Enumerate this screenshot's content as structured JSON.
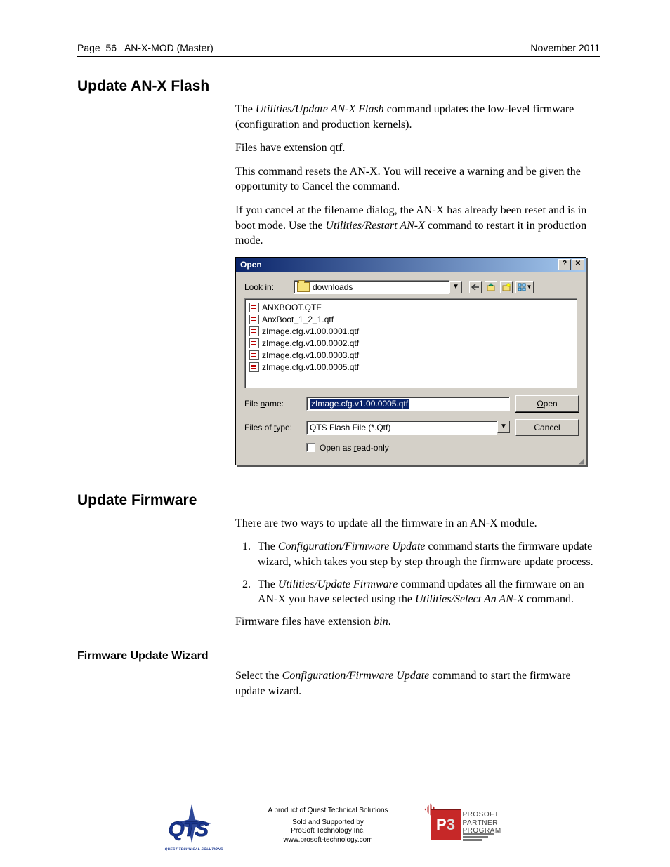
{
  "header": {
    "page_label": "Page",
    "page_number": "56",
    "doc_title": "AN-X-MOD (Master)",
    "date": "November 2011"
  },
  "s1": {
    "heading": "Update AN-X Flash",
    "p1_a": "The ",
    "p1_cmd": "Utilities/Update AN-X Flash",
    "p1_b": " command updates the low-level firmware (configuration and production kernels).",
    "p2": "Files have extension qtf.",
    "p3": "This command resets the AN-X.  You will receive a warning and be given the opportunity to Cancel the command.",
    "p4_a": "If you cancel at the filename dialog, the AN-X has already been reset and is in boot mode.  Use the ",
    "p4_cmd": "Utilities/Restart AN-X",
    "p4_b": " command to restart it in production mode."
  },
  "dialog": {
    "title": "Open",
    "lookin_label": "Look in:",
    "lookin_value": "downloads",
    "files": [
      "ANXBOOT.QTF",
      "AnxBoot_1_2_1.qtf",
      "zImage.cfg.v1.00.0001.qtf",
      "zImage.cfg.v1.00.0002.qtf",
      "zImage.cfg.v1.00.0003.qtf",
      "zImage.cfg.v1.00.0005.qtf"
    ],
    "filename_label": "File name:",
    "filename_value": "zImage.cfg.v1.00.0005.qtf",
    "filetype_label": "Files of type:",
    "filetype_value": "QTS Flash File (*.Qtf)",
    "readonly_label": "Open as read-only",
    "open_btn": "Open",
    "cancel_btn": "Cancel",
    "toolbar_icons": [
      "back-icon",
      "up-level-icon",
      "new-folder-icon",
      "views-icon"
    ]
  },
  "s2": {
    "heading": "Update Firmware",
    "p1": "There are two ways to update all the firmware in an AN-X module.",
    "li1_a": "The ",
    "li1_cmd": "Configuration/Firmware Update",
    "li1_b": " command starts the firmware update wizard, which takes you step by step through the firmware update process.",
    "li2_a": "The ",
    "li2_cmd1": "Utilities/Update Firmware",
    "li2_b": " command updates all the firmware on an AN-X you have selected using the ",
    "li2_cmd2": "Utilities/Select An AN-X",
    "li2_c": " command.",
    "p2_a": "Firmware files have extension ",
    "p2_em": "bin",
    "p2_b": "."
  },
  "s3": {
    "heading": "Firmware Update Wizard",
    "p1_a": "Select the ",
    "p1_cmd": "Configuration/Firmware Update",
    "p1_b": " command to start the firmware update wizard."
  },
  "footer": {
    "line1": "A product of Quest Technical Solutions",
    "line2": "Sold and Supported by",
    "line3": "ProSoft Technology Inc.",
    "line4": "www.prosoft-technology.com",
    "qts_text": "QTS",
    "qts_sub": "QUEST TECHNICAL SOLUTIONS",
    "p3_p": "P",
    "p3_3": "3",
    "p3_l1": "PROSOFT",
    "p3_l2": "PARTNER",
    "p3_l3": "PROGRAM"
  }
}
